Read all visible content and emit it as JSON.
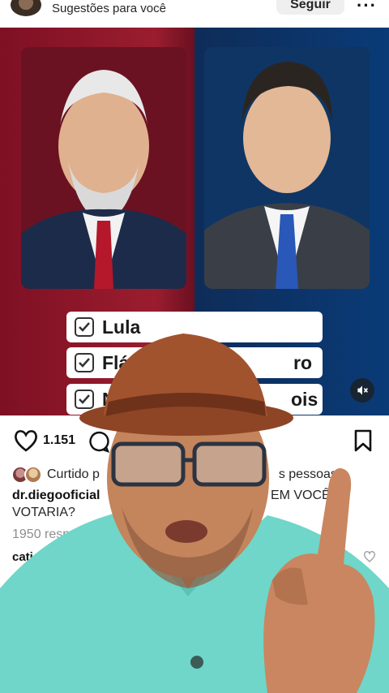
{
  "header": {
    "suggestion_text": "Sugestões para você",
    "follow_label": "Seguir",
    "more_label": "···"
  },
  "poll": {
    "options": [
      {
        "label": "Lula",
        "checked": true
      },
      {
        "label": "Flá",
        "checked": true
      },
      {
        "label": "N",
        "checked": true
      }
    ],
    "covered_suffixes": [
      "ro",
      "ois"
    ]
  },
  "actions": {
    "like_count": "1.151"
  },
  "liked_by": {
    "prefix": "Curtido p",
    "suffix": "s pessoas"
  },
  "caption": {
    "username": "dr.diegooficial",
    "text_right": "HOJE, EM VOCÊ",
    "text_line2": "VOTARIA?"
  },
  "comments": {
    "replies_text": "1950 respo",
    "commenter": "cati"
  },
  "colors": {
    "left_bg": "#9a1d2e",
    "right_bg": "#0a3b77",
    "overlay_shirt": "#6fd6c9",
    "hat": "#a1532e"
  },
  "icons": [
    "heart-icon",
    "comment-icon",
    "bookmark-icon",
    "mute-icon",
    "checkbox-icon",
    "more-icon"
  ]
}
